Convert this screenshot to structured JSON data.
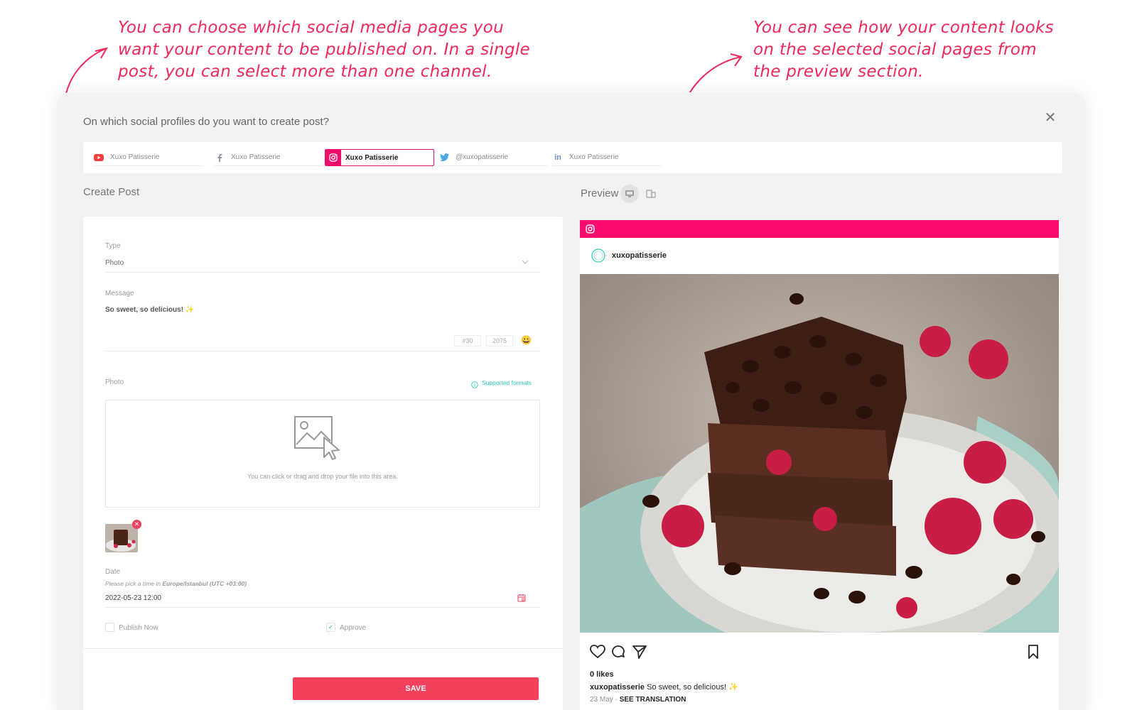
{
  "annotations": {
    "left": "You can choose which social media pages you want your content to be published on. In a single post, you can select more than one channel.",
    "right": "You can see how your content looks on the selected social pages from the preview section."
  },
  "modal": {
    "question": "On which social profiles do you want to create post?",
    "close_icon": "close-icon"
  },
  "profiles": [
    {
      "network": "youtube",
      "name": "Xuxo Patisserie",
      "selected": false,
      "color": "#ff3d3d"
    },
    {
      "network": "facebook",
      "name": "Xuxo Patisserie",
      "selected": false,
      "color": "#8a94a8"
    },
    {
      "network": "instagram",
      "name": "Xuxo Patisserie",
      "selected": true,
      "color": "#ee0f6c"
    },
    {
      "network": "twitter",
      "name": "@xuxopatisserie",
      "selected": false,
      "color": "#4aa8e8"
    },
    {
      "network": "linkedin",
      "name": "Xuxo Patisserie",
      "selected": false,
      "color": "#6b8fc4"
    }
  ],
  "create_post": {
    "title": "Create Post",
    "type_label": "Type",
    "type_value": "Photo",
    "message_label": "Message",
    "message_value": "So sweet, so delicious! ✨",
    "hashtag_count": "#30",
    "char_count": "2075",
    "photo_label": "Photo",
    "supported_formats": "Supported formats",
    "dropzone_text": "You can click or drag and drop your file into this area.",
    "date_label": "Date",
    "date_hint_prefix": "Please pick a time in ",
    "date_hint_tz": "Europe/Istanbul (UTC +03:00)",
    "date_value": "2022-05-23 12:00",
    "publish_now_label": "Publish Now",
    "publish_now_checked": false,
    "approve_label": "Approve",
    "approve_checked": true,
    "save_label": "SAVE"
  },
  "preview": {
    "title": "Preview",
    "account": "xuxopatisserie",
    "likes": "0 likes",
    "caption_user": "xuxopatisserie",
    "caption_text": "So sweet, so delicious! ✨",
    "date": "23 May",
    "separator": "·",
    "translation": "SEE TRANSLATION"
  },
  "colors": {
    "accent": "#f0295a",
    "instagram": "#fd0c6d",
    "save": "#f4405c",
    "teal": "#2cc8b2"
  }
}
